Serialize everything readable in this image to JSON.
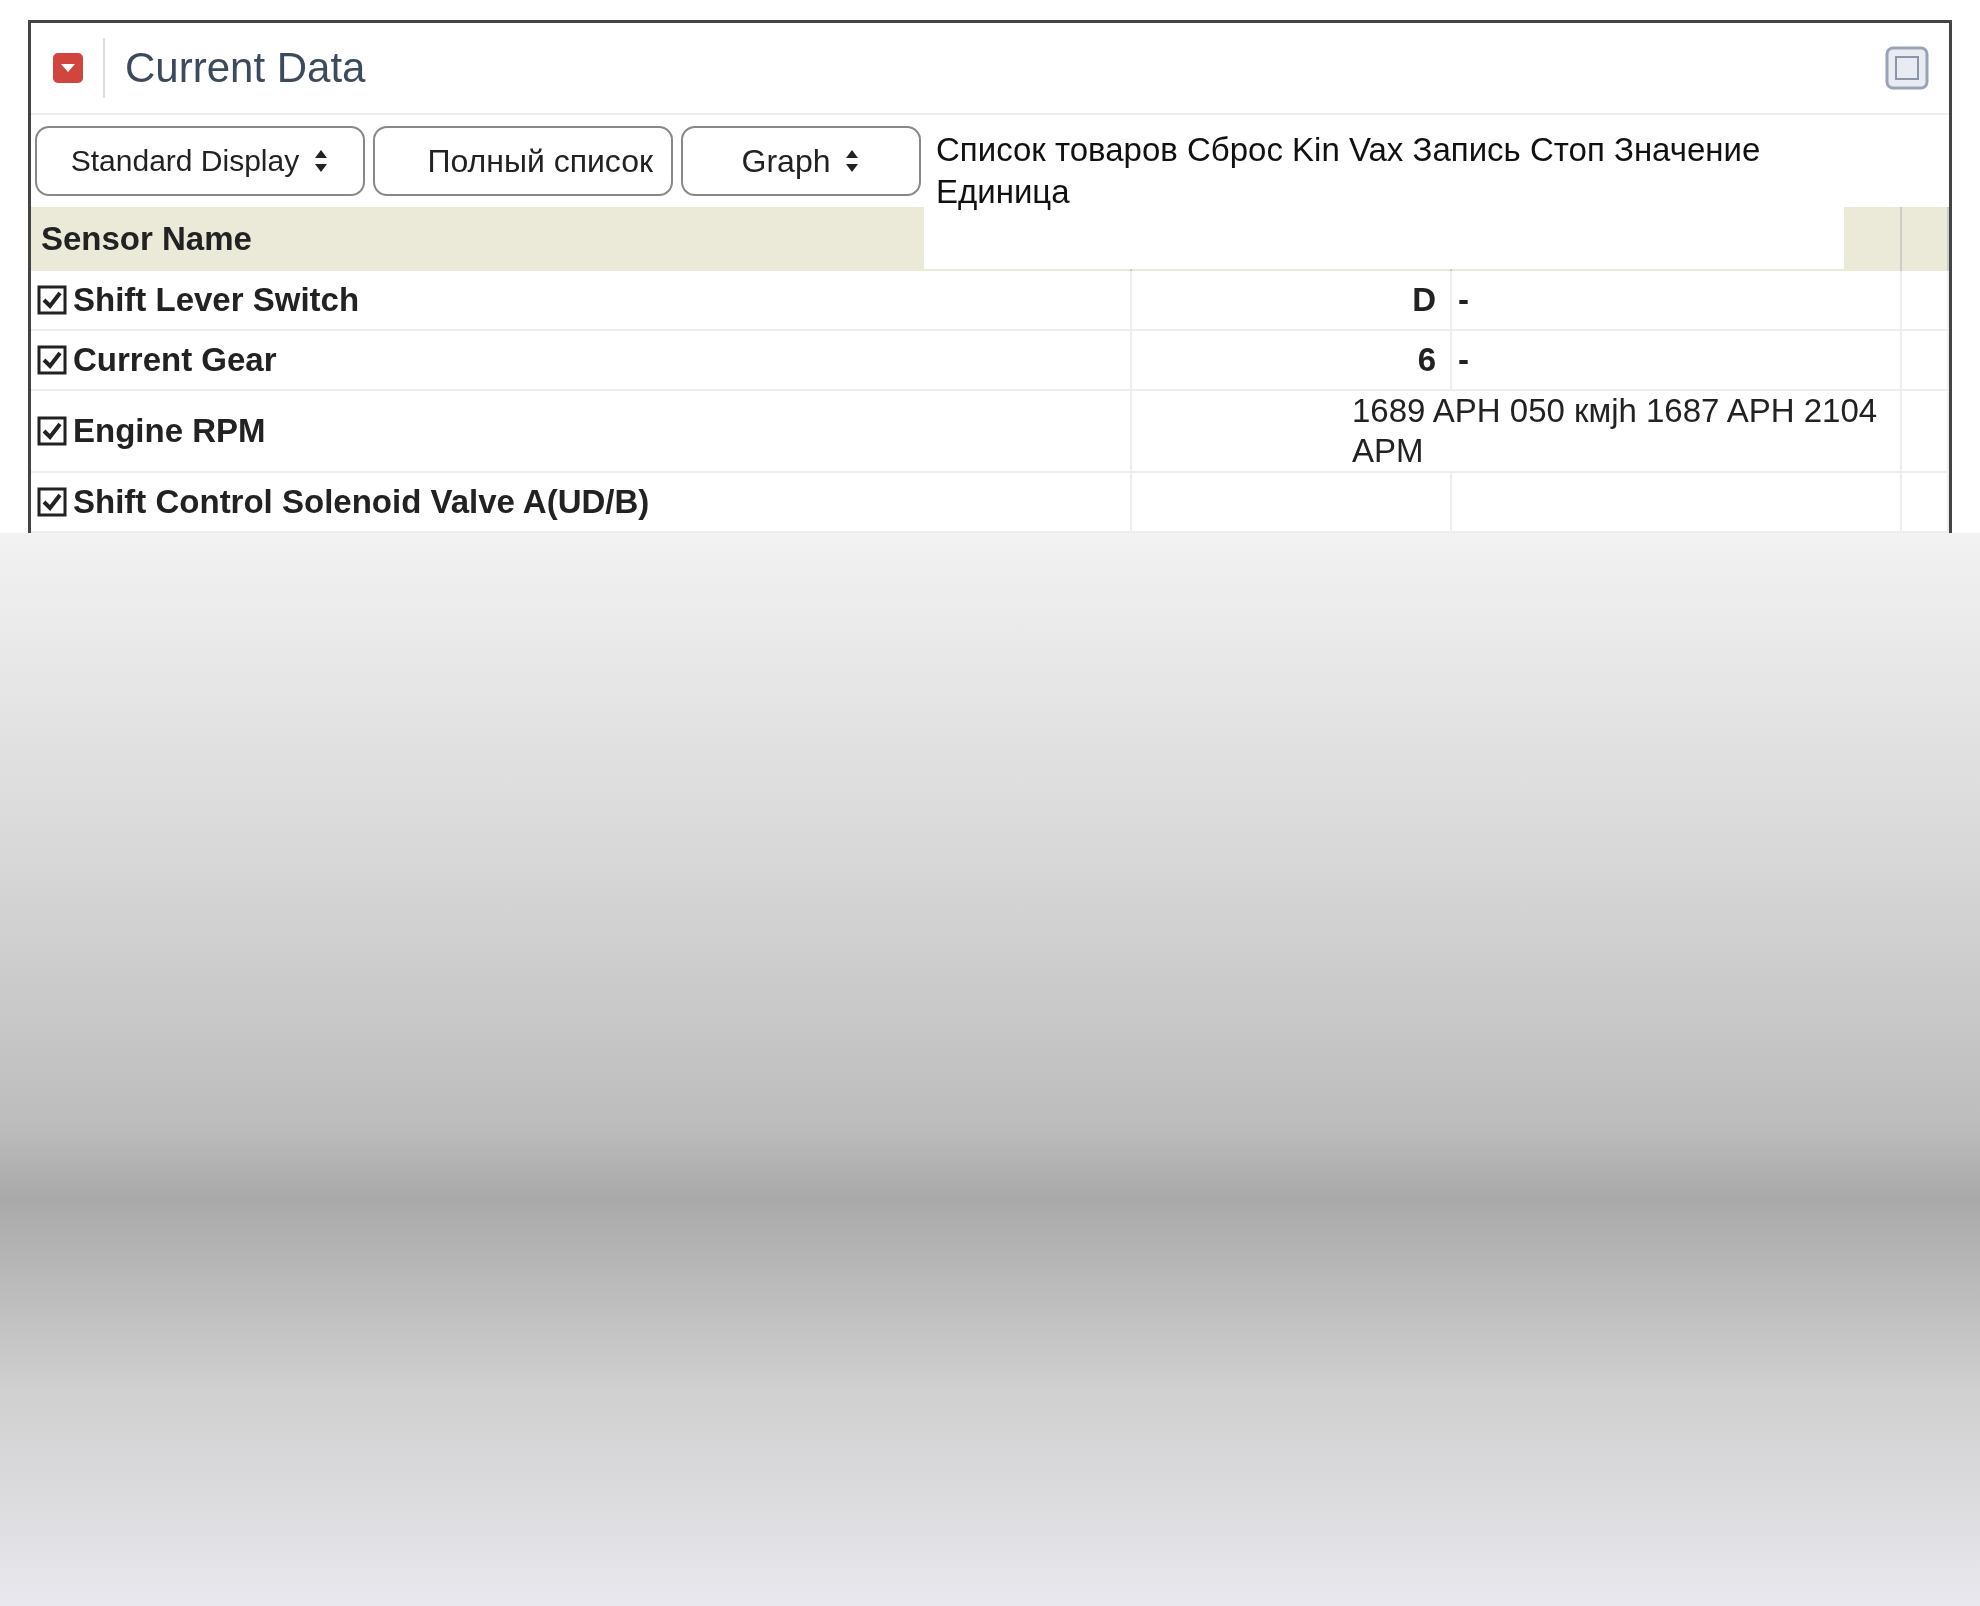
{
  "window": {
    "title": "Current Data"
  },
  "toolbar": [
    {
      "kind": "dropdown",
      "label": "Standard Display"
    },
    {
      "kind": "button",
      "label": "Полный список"
    },
    {
      "kind": "dropdown",
      "label": "Graph"
    }
  ],
  "overlay_text": "Список товаров Сброс Kin Vax Запись Стоп Значение Единица",
  "table": {
    "columns": [
      {
        "label": "Sensor Name"
      }
    ],
    "rows": [
      {
        "name": "Shift Lever Switch",
        "checked": true,
        "value": "D",
        "unit": "-"
      },
      {
        "name": "Current Gear",
        "checked": true,
        "value": "6",
        "unit": "-"
      },
      {
        "name": "Engine RPM",
        "checked": true,
        "value": "1689 APH 050 кмjh 1687 APH 2104 APM"
      },
      {
        "name": "Shift Control Solenoid Valve A(UD/B)",
        "checked": true
      }
    ]
  }
}
